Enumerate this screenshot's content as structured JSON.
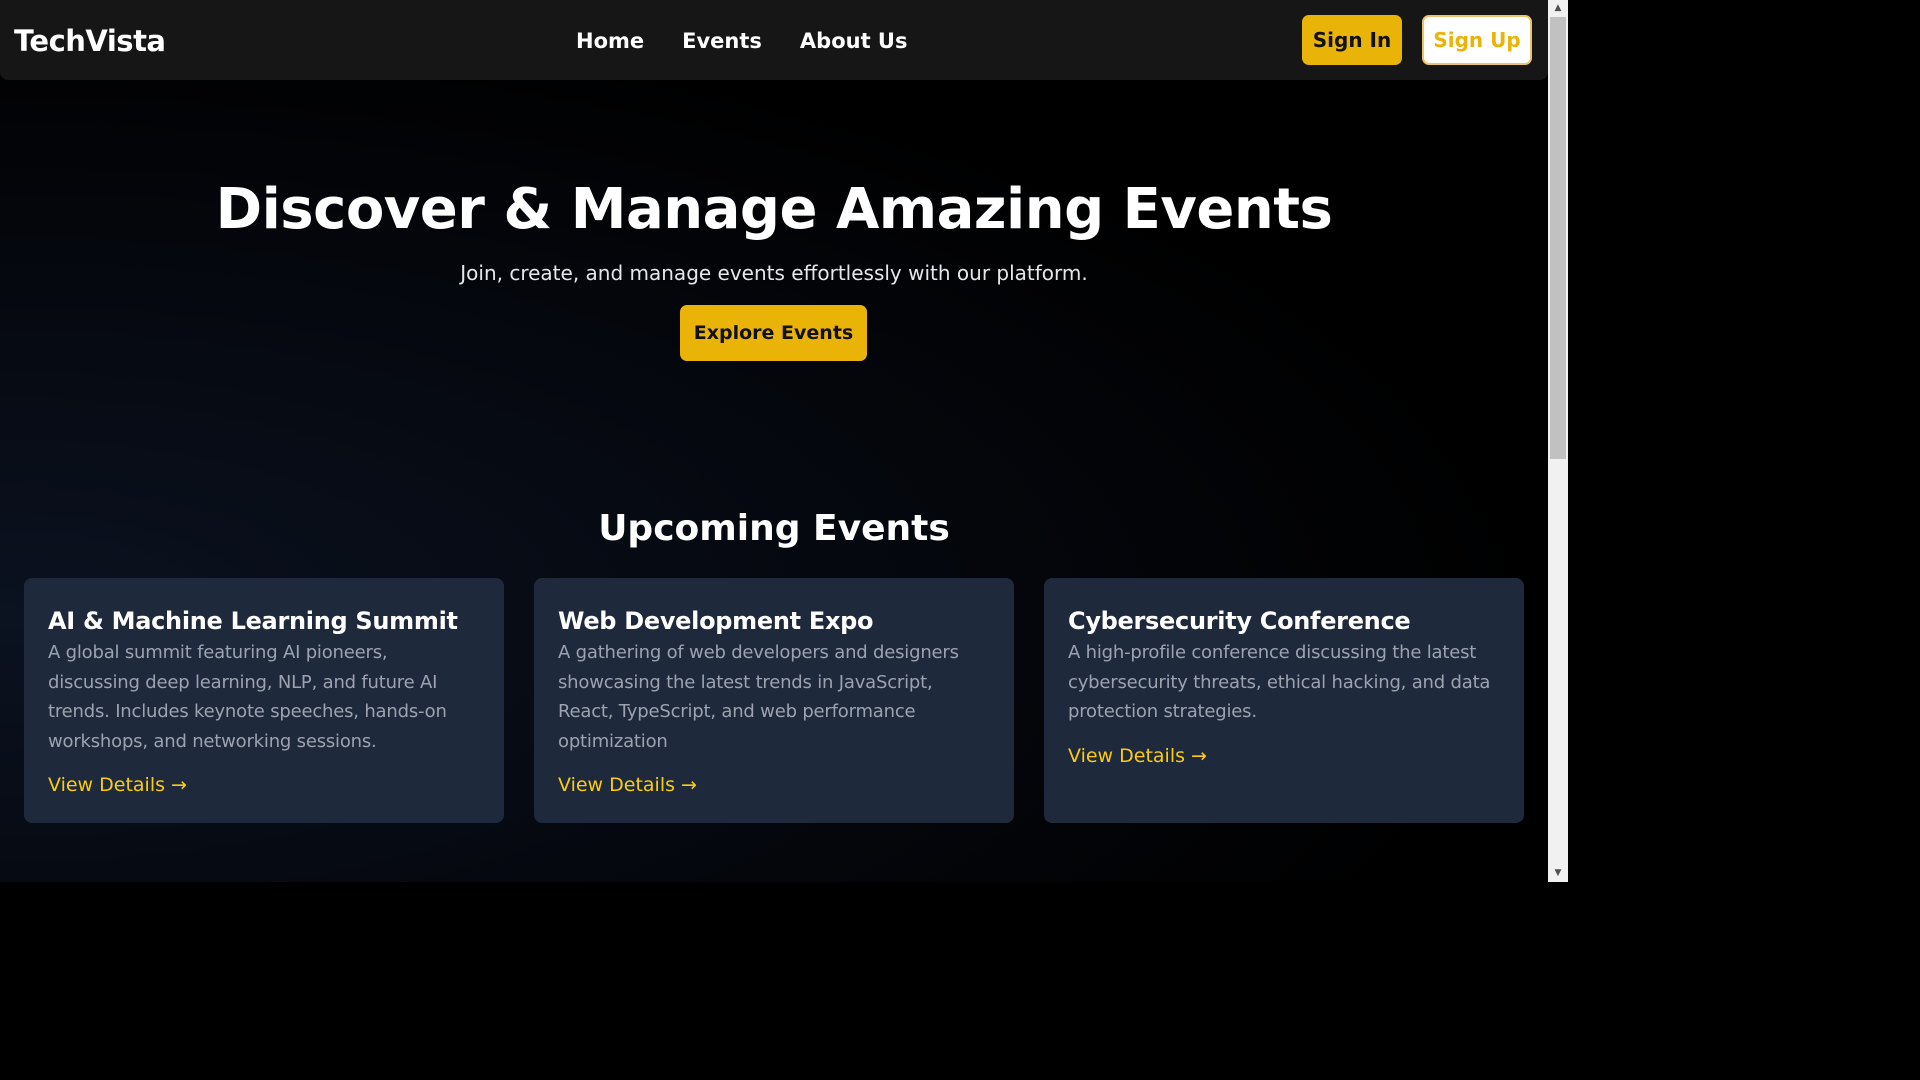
{
  "navbar": {
    "brand": "TechVista",
    "links": [
      {
        "label": "Home"
      },
      {
        "label": "Events"
      },
      {
        "label": "About Us"
      }
    ],
    "sign_in_label": "Sign In",
    "sign_up_label": "Sign Up"
  },
  "hero": {
    "title": "Discover & Manage Amazing Events",
    "subtitle": "Join, create, and manage events effortlessly with our platform.",
    "cta_label": "Explore Events"
  },
  "events_section": {
    "title": "Upcoming Events",
    "cards": [
      {
        "title": "AI & Machine Learning Summit",
        "description": "A global summit featuring AI pioneers, discussing deep learning, NLP, and future AI trends. Includes keynote speeches, hands-on workshops, and networking sessions.",
        "link_label": "View Details →"
      },
      {
        "title": "Web Development Expo",
        "description": "A gathering of web developers and designers showcasing the latest trends in JavaScript, React, TypeScript, and web performance optimization",
        "link_label": "View Details →"
      },
      {
        "title": "Cybersecurity Conference",
        "description": "A high-profile conference discussing the latest cybersecurity threats, ethical hacking, and data protection strategies.",
        "link_label": "View Details →"
      }
    ]
  },
  "scrollbar": {
    "up_icon": "chevron-up-icon",
    "down_icon": "chevron-down-icon"
  },
  "colors": {
    "accent": "#eab308",
    "link": "#facc15",
    "navbar_bg": "#161616",
    "card_bg": "#1e293b",
    "page_bg": "#000000"
  }
}
